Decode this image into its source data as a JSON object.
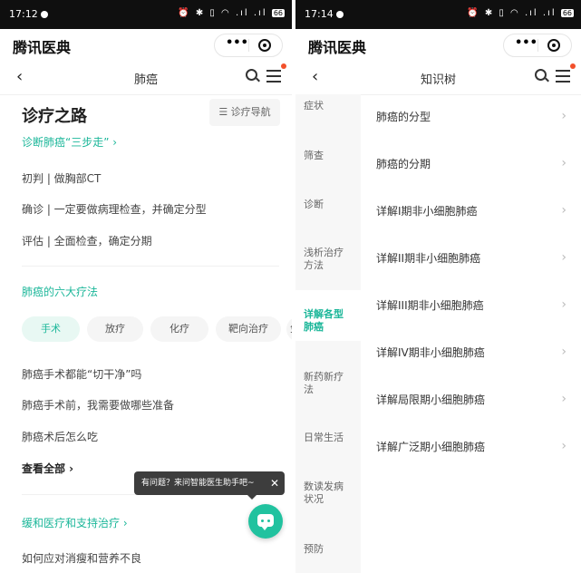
{
  "left": {
    "status": {
      "time": "17:12",
      "icons": "⏰ ✱ ▯ ◠ .ıl .ıl",
      "battery": "66"
    },
    "app_title": "腾讯医典",
    "capsule": {
      "more": "•••"
    },
    "nav": {
      "back": "‹",
      "title": "肺癌"
    },
    "section_title": "诊疗之路",
    "nav_button": "☰ 诊疗导航",
    "diagnosis_link": "诊断肺癌“三步走” ›",
    "diagnosis_steps": [
      "初判 | 做胸部CT",
      "确诊 | 一定要做病理检查，并确定分型",
      "评估 | 全面检查，确定分期"
    ],
    "treatments_title": "肺癌的六大疗法",
    "treatment_chips": [
      "手术",
      "放疗",
      "化疗",
      "靶向治疗",
      "免"
    ],
    "surgery_questions": [
      "肺癌手术都能“切干净”吗",
      "肺癌手术前，我需要做哪些准备",
      "肺癌术后怎么吃"
    ],
    "see_all": "查看全部 ›",
    "palliative_link": "缓和医疗和支持治疗 ›",
    "palliative_item": "如何应对消瘦和营养不良",
    "tooltip": {
      "text": "有问题？来问智能医生助手吧~",
      "close": "✕"
    }
  },
  "right": {
    "status": {
      "time": "17:14",
      "icons": "⏰ ✱ ▯ ◠ .ıl .ıl",
      "battery": "66"
    },
    "app_title": "腾讯医典",
    "capsule": {
      "more": "•••"
    },
    "nav": {
      "back": "‹",
      "title": "知识树"
    },
    "sidebar": [
      "症状",
      "筛查",
      "诊断",
      "浅析治疗方法",
      "详解各型肺癌",
      "新药新疗法",
      "日常生活",
      "数读发病状况",
      "预防"
    ],
    "sidebar_active_index": 4,
    "tree_items": [
      "肺癌的分型",
      "肺癌的分期",
      "详解I期非小细胞肺癌",
      "详解II期非小细胞肺癌",
      "详解III期非小细胞肺癌",
      "详解IV期非小细胞肺癌",
      "详解局限期小细胞肺癌",
      "详解广泛期小细胞肺癌"
    ],
    "chevron": "›"
  },
  "colors": {
    "accent": "#1db79a",
    "fab": "#21c29f",
    "badge": "#f2502b"
  }
}
